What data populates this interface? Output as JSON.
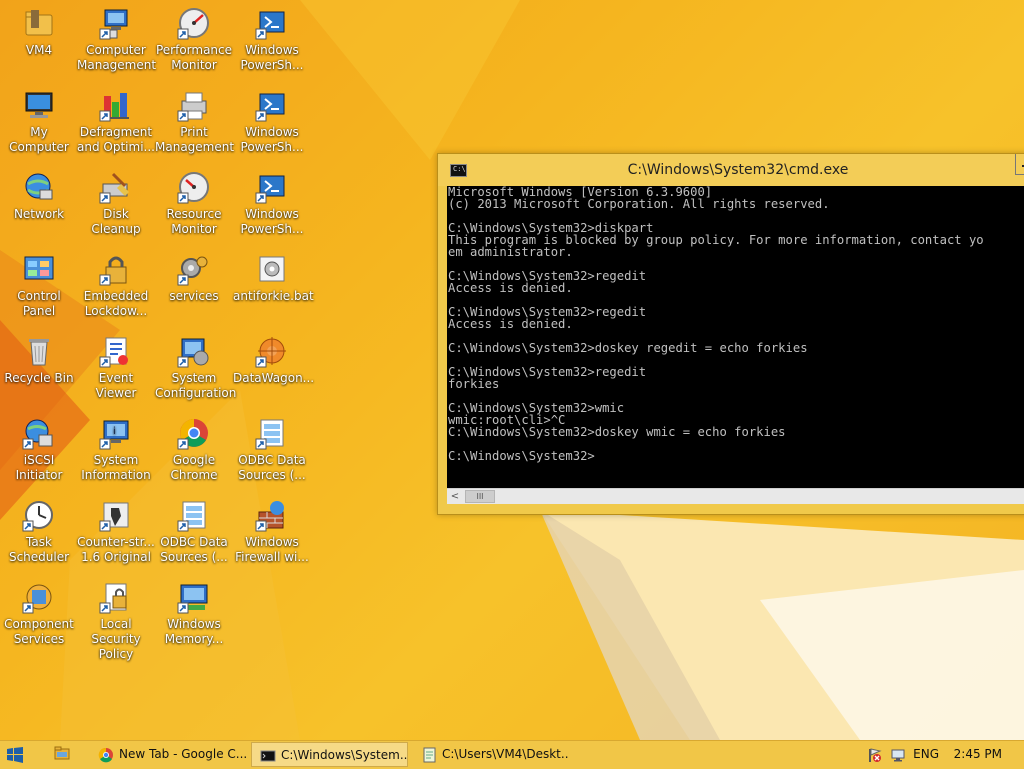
{
  "desktop": {
    "icons": [
      {
        "label": "VM4",
        "icon": "folder-icon"
      },
      {
        "label": "Computer Management",
        "icon": "computer-management-icon"
      },
      {
        "label": "Performance Monitor",
        "icon": "performance-monitor-icon"
      },
      {
        "label": "Windows PowerSh...",
        "icon": "powershell-icon"
      },
      {
        "label": "My Computer",
        "icon": "my-computer-icon"
      },
      {
        "label": "Defragment and Optimi...",
        "icon": "defragment-icon"
      },
      {
        "label": "Print Management",
        "icon": "print-management-icon"
      },
      {
        "label": "Windows PowerSh...",
        "icon": "powershell-icon"
      },
      {
        "label": "Network",
        "icon": "network-icon"
      },
      {
        "label": "Disk Cleanup",
        "icon": "disk-cleanup-icon"
      },
      {
        "label": "Resource Monitor",
        "icon": "resource-monitor-icon"
      },
      {
        "label": "Windows PowerSh...",
        "icon": "powershell-icon"
      },
      {
        "label": "Control Panel",
        "icon": "control-panel-icon"
      },
      {
        "label": "Embedded Lockdow...",
        "icon": "embedded-lockdown-icon"
      },
      {
        "label": "services",
        "icon": "services-icon"
      },
      {
        "label": "antiforkie.bat",
        "icon": "batch-file-icon"
      },
      {
        "label": "Recycle Bin",
        "icon": "recycle-bin-icon"
      },
      {
        "label": "Event Viewer",
        "icon": "event-viewer-icon"
      },
      {
        "label": "System Configuration",
        "icon": "system-configuration-icon"
      },
      {
        "label": "DataWagon...",
        "icon": "datawagon-icon"
      },
      {
        "label": "iSCSI Initiator",
        "icon": "iscsi-initiator-icon"
      },
      {
        "label": "System Information",
        "icon": "system-information-icon"
      },
      {
        "label": "Google Chrome",
        "icon": "chrome-icon"
      },
      {
        "label": "ODBC Data Sources (...",
        "icon": "odbc-icon"
      },
      {
        "label": "Task Scheduler",
        "icon": "task-scheduler-icon"
      },
      {
        "label": "Counter-str... 1.6 Original",
        "icon": "counter-strike-icon"
      },
      {
        "label": "ODBC Data Sources (...",
        "icon": "odbc-icon"
      },
      {
        "label": "Windows Firewall wi...",
        "icon": "firewall-icon"
      },
      {
        "label": "Component Services",
        "icon": "component-services-icon"
      },
      {
        "label": "Local Security Policy",
        "icon": "local-security-policy-icon"
      },
      {
        "label": "Windows Memory...",
        "icon": "memory-diagnostic-icon"
      }
    ]
  },
  "cmd": {
    "title": "C:\\Windows\\System32\\cmd.exe",
    "icon_text": "C:\\",
    "output": "Microsoft Windows [Version 6.3.9600]\n(c) 2013 Microsoft Corporation. All rights reserved.\n\nC:\\Windows\\System32>diskpart\nThis program is blocked by group policy. For more information, contact yo\nem administrator.\n\nC:\\Windows\\System32>regedit\nAccess is denied.\n\nC:\\Windows\\System32>regedit\nAccess is denied.\n\nC:\\Windows\\System32>doskey regedit = echo forkies\n\nC:\\Windows\\System32>regedit\nforkies\n\nC:\\Windows\\System32>wmic\nwmic:root\\cli>^C\nC:\\Windows\\System32>doskey wmic = echo forkies\n\nC:\\Windows\\System32>",
    "scroll_left": "<",
    "scroll_thumb": "III"
  },
  "taskbar": {
    "items": [
      {
        "label": "New Tab - Google C...",
        "icon": "chrome-icon",
        "active": false
      },
      {
        "label": "C:\\Windows\\System...",
        "icon": "cmd-icon",
        "active": true
      },
      {
        "label": "C:\\Users\\VM4\\Deskt...",
        "icon": "notepad-icon",
        "active": false
      }
    ],
    "language": "ENG",
    "time": "2:45 PM"
  }
}
